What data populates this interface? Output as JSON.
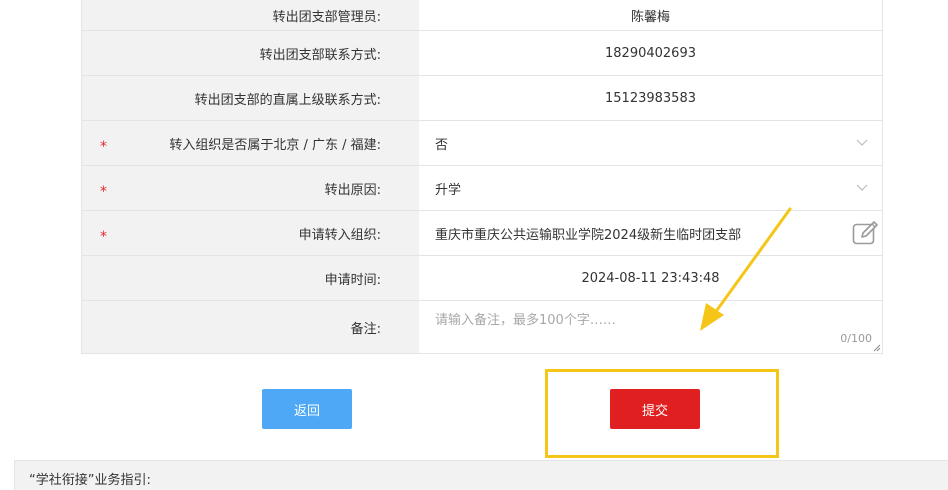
{
  "form": {
    "rows": [
      {
        "label": "转出团支部管理员:",
        "value": "陈馨梅"
      },
      {
        "label": "转出团支部联系方式:",
        "value": "18290402693"
      },
      {
        "label": "转出团支部的直属上级联系方式:",
        "value": "15123983583"
      },
      {
        "label": "转入组织是否属于北京 / 广东 / 福建:",
        "value": "否",
        "required": "*"
      },
      {
        "label": "转出原因:",
        "value": "升学",
        "required": "*"
      },
      {
        "label": "申请转入组织:",
        "value": "重庆市重庆公共运输职业学院2024级新生临时团支部",
        "required": "*"
      },
      {
        "label": "申请时间:",
        "value": "2024-08-11 23:43:48"
      }
    ],
    "remarks": {
      "label": "备注:",
      "placeholder": "请输入备注，最多100个字……",
      "counter": "0/100"
    }
  },
  "buttons": {
    "back": "返回",
    "submit": "提交"
  },
  "guide": {
    "title": "“学社衔接”业务指引:"
  },
  "icons": {
    "dropdown": "chevron-down-icon",
    "edit": "edit-icon"
  },
  "colors": {
    "back_button": "#4ea8f5",
    "submit_button": "#e02020",
    "required_mark": "#e4282c",
    "highlight": "#f5c518"
  }
}
